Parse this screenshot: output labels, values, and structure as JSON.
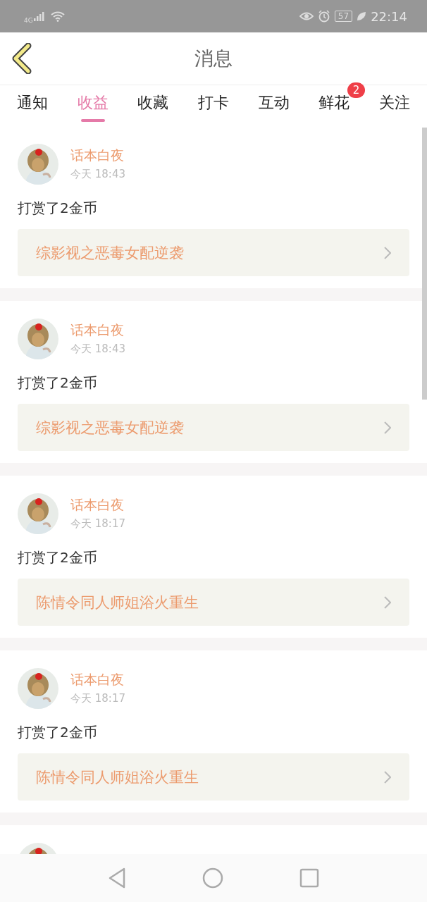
{
  "status_bar": {
    "network": "4G",
    "battery": "57",
    "time": "22:14"
  },
  "header": {
    "title": "消息"
  },
  "tabs": [
    {
      "label": "通知",
      "selected": false
    },
    {
      "label": "收益",
      "selected": true
    },
    {
      "label": "收藏",
      "selected": false
    },
    {
      "label": "打卡",
      "selected": false
    },
    {
      "label": "互动",
      "selected": false
    },
    {
      "label": "鲜花",
      "selected": false,
      "badge": "2"
    },
    {
      "label": "关注",
      "selected": false
    }
  ],
  "messages": [
    {
      "user": "话本白夜",
      "time": "今天 18:43",
      "text": "打赏了2金币",
      "book": "综影视之恶毒女配逆袭"
    },
    {
      "user": "话本白夜",
      "time": "今天 18:43",
      "text": "打赏了2金币",
      "book": "综影视之恶毒女配逆袭"
    },
    {
      "user": "话本白夜",
      "time": "今天 18:17",
      "text": "打赏了2金币",
      "book": "陈情令同人师姐浴火重生"
    },
    {
      "user": "话本白夜",
      "time": "今天 18:17",
      "text": "打赏了2金币",
      "book": "陈情令同人师姐浴火重生"
    }
  ]
}
